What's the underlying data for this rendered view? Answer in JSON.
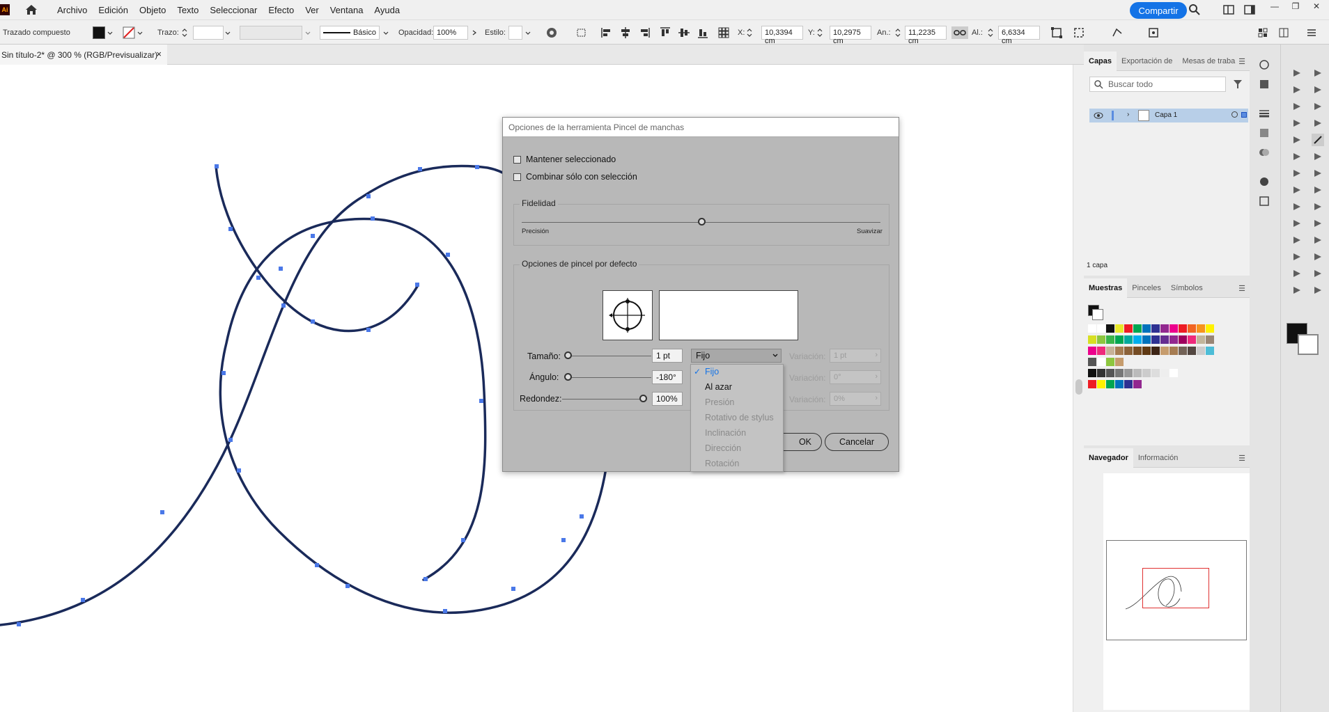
{
  "app": {
    "logo": "Ai"
  },
  "menubar": {
    "items": [
      "Archivo",
      "Edición",
      "Objeto",
      "Texto",
      "Seleccionar",
      "Efecto",
      "Ver",
      "Ventana",
      "Ayuda"
    ],
    "share_label": "Compartir"
  },
  "controlbar": {
    "object_type": "Trazado compuesto",
    "stroke_label": "Trazo:",
    "brush_label": "Básico",
    "opacity_label": "Opacidad:",
    "opacity_value": "100%",
    "style_label": "Estilo:",
    "x_label": "X:",
    "x_value": "10,3394 cm",
    "y_label": "Y:",
    "y_value": "10,2975 cm",
    "w_label": "An.:",
    "w_value": "11,2235 cm",
    "h_label": "Al.:",
    "h_value": "6,6334 cm"
  },
  "document": {
    "tab_title": "Sin título-2* @ 300 % (RGB/Previsualizar)",
    "close": "×"
  },
  "dialog": {
    "title": "Opciones de la herramienta Pincel de manchas",
    "keep_selected": "Mantener seleccionado",
    "merge_only": "Combinar sólo con selección",
    "fidelity_title": "Fidelidad",
    "fidelity_left": "Precisión",
    "fidelity_right": "Suavizar",
    "fidelity_level": 0.5,
    "brush_options_title": "Opciones de pincel por defecto",
    "size_label": "Tamaño:",
    "size_value": "1 pt",
    "size_mode": "Fijo",
    "angle_label": "Ángulo:",
    "angle_value": "-180°",
    "roundness_label": "Redondez:",
    "roundness_value": "100%",
    "variation_label": "Variación:",
    "size_variation": "1 pt",
    "angle_variation": "0°",
    "roundness_variation": "0%",
    "ok_label": "OK",
    "cancel_label": "Cancelar"
  },
  "dropdown": {
    "items": [
      "Fijo",
      "Al azar",
      "Presión",
      "Rotativo de stylus",
      "Inclinación",
      "Dirección",
      "Rotación"
    ],
    "selected": "Fijo",
    "check": "✓"
  },
  "layers_panel": {
    "tabs": [
      "Capas",
      "Exportación de",
      "Mesas de traba"
    ],
    "search_placeholder": "Buscar todo",
    "layer_name": "Capa 1",
    "count": "1 capa"
  },
  "swatches_panel": {
    "tabs": [
      "Muestras",
      "Pinceles",
      "Símbolos"
    ]
  },
  "navigator_panel": {
    "tabs": [
      "Navegador",
      "Información"
    ]
  },
  "colors": {
    "accent": "#1473e6",
    "path": "#1a2a5a",
    "anchor": "#4a78e8",
    "dialog_bg": "#b8b8b8",
    "nav_box": "#e03030"
  }
}
